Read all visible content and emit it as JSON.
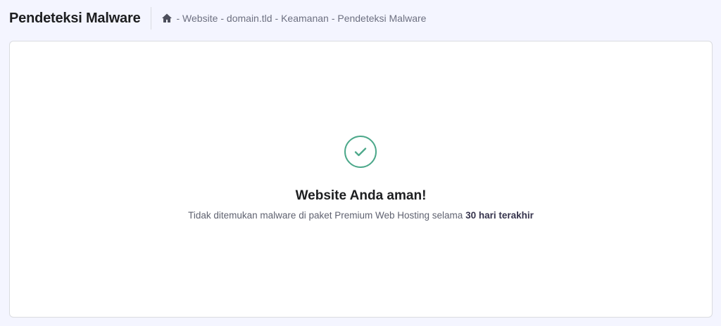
{
  "header": {
    "title": "Pendeteksi Malware"
  },
  "breadcrumb": [
    "- Website",
    "- domain.tld",
    "- Keamanan",
    "- Pendeteksi Malware"
  ],
  "status": {
    "title": "Website Anda aman!",
    "message": "Tidak ditemukan malware di paket Premium Web Hosting selama",
    "period": "30 hari terakhir",
    "color": "#4ca88a"
  }
}
